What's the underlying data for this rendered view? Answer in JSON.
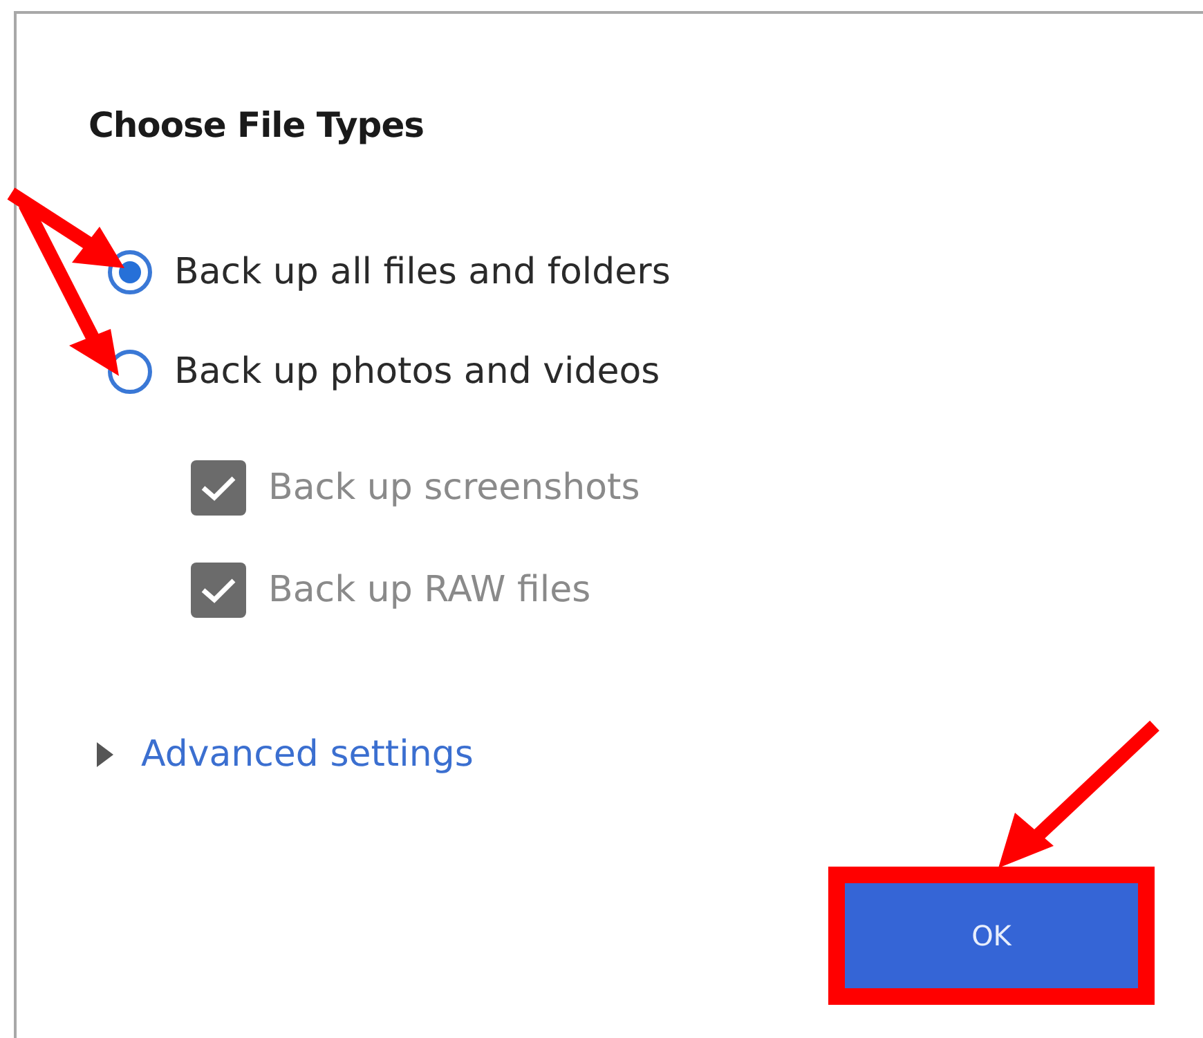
{
  "section": {
    "title": "Choose File Types"
  },
  "radios": [
    {
      "label": "Back up all files and folders",
      "selected": true
    },
    {
      "label": "Back up photos and videos",
      "selected": false
    }
  ],
  "checkboxes": [
    {
      "label": "Back up screenshots",
      "checked": true,
      "disabled": true
    },
    {
      "label": "Back up RAW files",
      "checked": true,
      "disabled": true
    }
  ],
  "advanced": {
    "label": "Advanced settings",
    "expanded": false
  },
  "buttons": [
    {
      "label": "OK",
      "highlighted": true
    }
  ]
}
